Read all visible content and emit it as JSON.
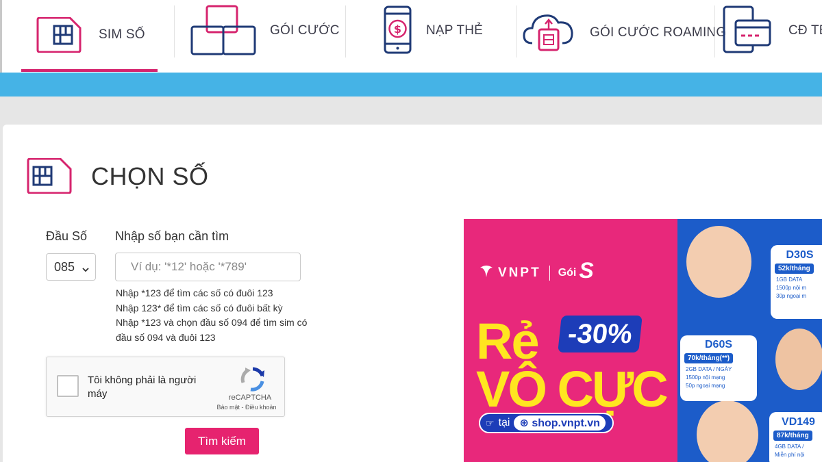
{
  "nav": {
    "items": [
      {
        "label": "SIM SỐ",
        "icon": "sim-card-icon",
        "active": true
      },
      {
        "label": "GÓI CƯỚC",
        "icon": "package-boxes-icon"
      },
      {
        "label": "NẠP THẺ",
        "icon": "phone-topup-icon"
      },
      {
        "label": "GÓI CƯỚC ROAMING",
        "icon": "cloud-sim-icon"
      },
      {
        "label": "CĐ TB",
        "icon": "card-icon"
      }
    ]
  },
  "colors": {
    "accent": "#d6246e",
    "nav_icon": "#1f3a76",
    "bluebar": "#45b3e6",
    "button": "#e6236f"
  },
  "section": {
    "title": "CHỌN SỐ",
    "icon": "sim-card-icon"
  },
  "form": {
    "prefix_label": "Đầu Số",
    "prefix_value": "085",
    "search_label": "Nhập số bạn cần tìm",
    "search_placeholder": "Ví dụ: '*12' hoặc '*789'",
    "hints": [
      "Nhập *123 để tìm các số có đuôi 123",
      "Nhập 123* để tìm các số có đuôi bất kỳ",
      "Nhập *123 và chọn đầu số 094 để tìm sim có đầu số 094 và đuôi 123"
    ],
    "captcha_text": "Tôi không phải là người máy",
    "captcha_brand": "reCAPTCHA",
    "captcha_terms": "Bảo mật - Điều khoản",
    "submit_label": "Tìm kiếm"
  },
  "banner": {
    "brand": "VNPT",
    "sub": "Gói",
    "sub_mark": "S",
    "headline_1": "Rẻ",
    "headline_2": "VÔ CỰC",
    "discount": "-30%",
    "cta_at": "tại",
    "cta_url": "shop.vnpt.vn",
    "packages": [
      {
        "name": "D30S",
        "price": "52k/tháng",
        "features": [
          "1GB DATA",
          "1500p nội m",
          "30p ngoại m"
        ]
      },
      {
        "name": "D60S",
        "price": "70k/tháng(**)",
        "features": [
          "2GB DATA / NGÀY",
          "1500p nội mạng",
          "50p ngoại mạng"
        ]
      },
      {
        "name": "VD149",
        "price": "87k/tháng",
        "features": [
          "4GB DATA /",
          "Miễn phí nội"
        ]
      }
    ]
  }
}
